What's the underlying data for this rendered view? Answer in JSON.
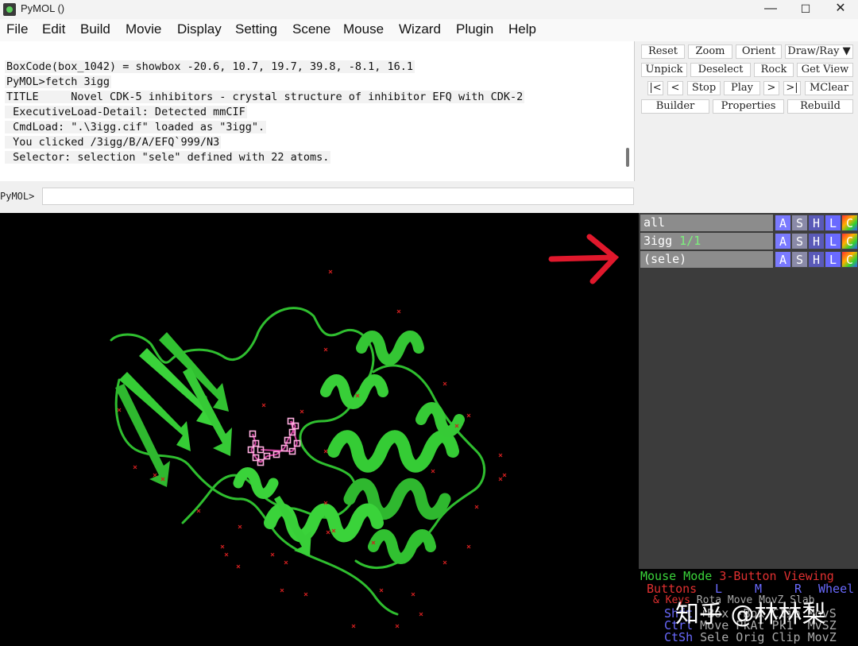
{
  "window": {
    "title": "PyMOL ()",
    "minimize": "—",
    "maximize": "☐",
    "close": "✕"
  },
  "menu": [
    "File",
    "Edit",
    "Build",
    "Movie",
    "Display",
    "Setting",
    "Scene",
    "Mouse",
    "Wizard",
    "Plugin",
    "Help"
  ],
  "console": {
    "lines": [
      "BoxCode(box_1042) = showbox -20.6, 10.7, 19.7, 39.8, -8.1, 16.1",
      "PyMOL>fetch 3igg",
      "TITLE     Novel CDK-5 inhibitors - crystal structure of inhibitor EFQ with CDK-2",
      " ExecutiveLoad-Detail: Detected mmCIF",
      " CmdLoad: \".\\3igg.cif\" loaded as \"3igg\".",
      " You clicked /3igg/B/A/EFQ`999/N3",
      " Selector: selection \"sele\" defined with 22 atoms."
    ]
  },
  "command": {
    "prompt": "PyMOL>",
    "value": ""
  },
  "buttons": {
    "reset": "Reset",
    "zoom": "Zoom",
    "orient": "Orient",
    "draw_ray": "Draw/Ray ▼",
    "unpick": "Unpick",
    "deselect": "Deselect",
    "rock": "Rock",
    "get_view": "Get View",
    "first": "|<",
    "prev": "<",
    "stop": "Stop",
    "play": "Play",
    "next": ">",
    "last": ">|",
    "mclear": "MClear",
    "builder": "Builder",
    "properties": "Properties",
    "rebuild": "Rebuild"
  },
  "objects": [
    {
      "name": "all",
      "count": ""
    },
    {
      "name": "3igg",
      "count": "1/1"
    },
    {
      "name": "(sele)",
      "count": ""
    }
  ],
  "object_buttons": [
    "A",
    "S",
    "H",
    "L",
    "C"
  ],
  "object_button_colors": {
    "A": "#7a7aff",
    "S": "#8a8aa8",
    "H": "#5a5ab8",
    "L": "#6a6aff"
  },
  "mouse_info": {
    "line1_a": "Mouse Mode ",
    "line1_b": "3-Button Viewing",
    "line2_a": "Buttons",
    "line2_b": "L",
    "line2_c": "M",
    "line2_d": "R",
    "line2_e": "Wheel",
    "line3_a": "& Keys",
    "line3_b": "Rota Move MovZ Slab",
    "line4_a": "Shft",
    "line4_b": "+Box -Box Clip MovS",
    "line5_a": "Ctrl",
    "line5_b": "Move PkAt Pk1  MvSZ",
    "line6_a": "CtSh",
    "line6_b": "Sele Orig Clip MovZ"
  },
  "colors": {
    "protein": "#3ad33a",
    "arrow": "#e0182c",
    "selection": "#e050b0"
  },
  "watermark": "知乎 @林林梨"
}
